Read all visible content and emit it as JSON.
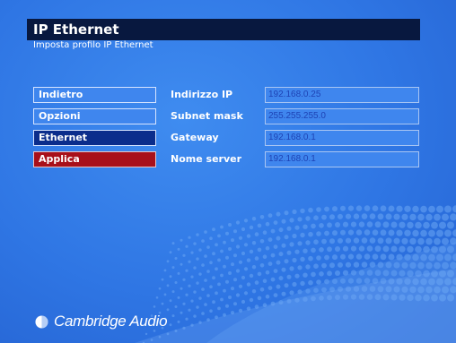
{
  "header": {
    "title": "IP Ethernet",
    "subtitle": "Imposta profilo IP Ethernet"
  },
  "menu": {
    "items": [
      {
        "label": "Indietro",
        "state": "normal"
      },
      {
        "label": "Opzioni",
        "state": "normal"
      },
      {
        "label": "Ethernet",
        "state": "selected"
      },
      {
        "label": "Applica",
        "state": "action"
      }
    ]
  },
  "fields": [
    {
      "label": "Indirizzo IP",
      "value": "192.168.0.25"
    },
    {
      "label": "Subnet mask",
      "value": "255.255.255.0"
    },
    {
      "label": "Gateway",
      "value": "192.168.0.1"
    },
    {
      "label": "Nome server",
      "value": "192.168.0.1"
    }
  ],
  "brand": {
    "name": "Cambridge Audio",
    "logo_icon": "cambridge-audio-logo-icon"
  },
  "colors": {
    "background": "#2f76e4",
    "title_bar": "#08183f",
    "selected": "#0b2d8c",
    "action": "#a8101a",
    "value_text": "#1e43b5"
  }
}
